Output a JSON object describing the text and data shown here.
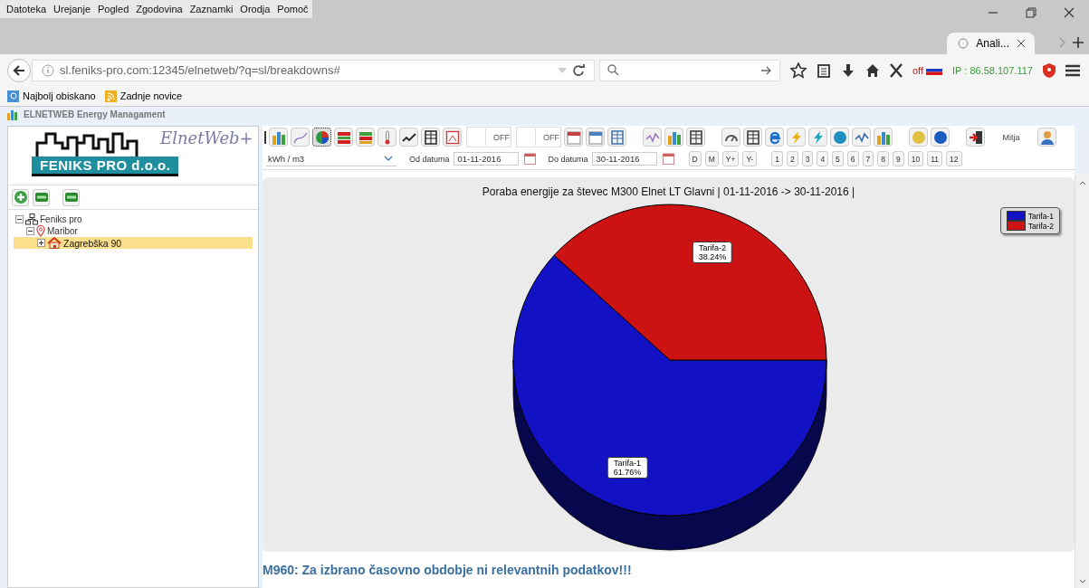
{
  "browser": {
    "menu": [
      "Datoteka",
      "Urejanje",
      "Pogled",
      "Zgodovina",
      "Zaznamki",
      "Orodja",
      "Pomoč"
    ],
    "tab": {
      "title": "Anali..."
    },
    "url": "sl.feniks-pro.com:12345/elnetweb/?q=sl/breakdowns#",
    "addon_status": "off",
    "ip": "IP : 86.58.107.117",
    "bookmarks": [
      "Najbolj obiskano",
      "Zadnje novice"
    ],
    "page_title": "ELNETWEB Energy Managament"
  },
  "logo": {
    "script": "ElnetWeb+",
    "company": "FENIKS PRO d.o.o."
  },
  "tree": [
    {
      "label": "Feniks pro",
      "kind": "network",
      "expanded": true,
      "selected": false,
      "children": [
        {
          "label": "Maribor",
          "kind": "pin",
          "expanded": true,
          "selected": false,
          "children": [
            {
              "label": "Zagrebška 90",
              "kind": "house",
              "expanded": false,
              "selected": true
            }
          ]
        }
      ]
    }
  ],
  "chart_buttons": [
    {
      "kind": "bar",
      "selected": false
    },
    {
      "kind": "line",
      "selected": false
    },
    {
      "kind": "pie",
      "selected": true
    },
    {
      "kind": "stack",
      "selected": false
    },
    {
      "kind": "stack2",
      "selected": false
    },
    {
      "kind": "thermo",
      "selected": false
    },
    {
      "kind": "trend",
      "selected": false
    },
    {
      "kind": "table",
      "selected": false
    },
    {
      "kind": "pdf",
      "selected": false
    }
  ],
  "toggles": [
    {
      "label": "OFF",
      "on": false
    },
    {
      "label": "OFF",
      "on": false
    }
  ],
  "user": "Mitja",
  "unit": "kWh / m3",
  "from_label": "Od datuma",
  "from_date": "01-11-2016",
  "to_label": "Do datuma",
  "to_date": "30-11-2016",
  "period_buttons": [
    "D",
    "M",
    "Y+",
    "Y-"
  ],
  "month_buttons": [
    "1",
    "2",
    "3",
    "4",
    "5",
    "6",
    "7",
    "8",
    "9",
    "10",
    "11",
    "12"
  ],
  "chart": {
    "chart_data": {
      "type": "pie",
      "title": "Poraba energije za števec M300 Elnet LT Glavni | 01-11-2016 -> 30-11-2016 |",
      "categories": [
        "Tarifa-1",
        "Tarifa-2"
      ],
      "values": [
        61.76,
        38.24
      ],
      "colors": [
        "#1212c4",
        "#cc1212"
      ],
      "data_labels": true,
      "value_labels": [
        "61.76%",
        "38.24%"
      ]
    }
  },
  "message": "M960: Za izbrano časovno obdobje ni relevantnih podatkov!!!"
}
